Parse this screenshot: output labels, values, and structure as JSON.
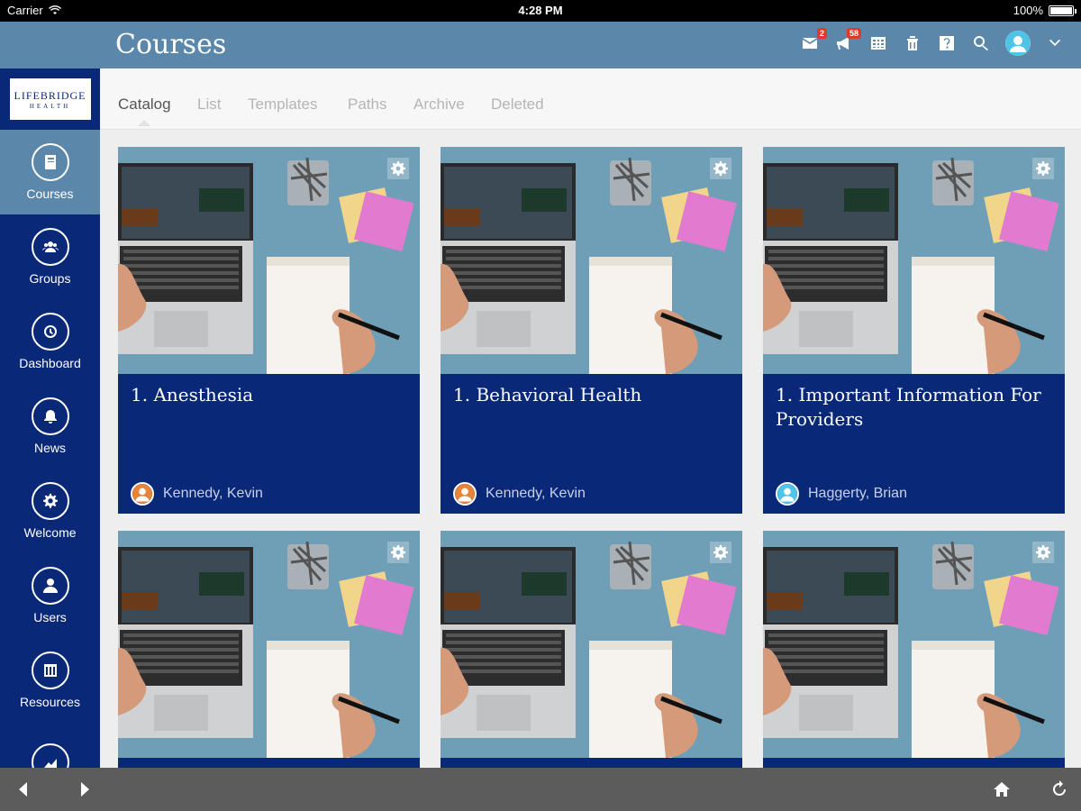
{
  "status": {
    "carrier": "Carrier",
    "time": "4:28 PM",
    "battery": "100%"
  },
  "header": {
    "title": "Courses",
    "mail_badge": "2",
    "announce_badge": "58"
  },
  "logo": {
    "line1": "LIFEBRIDGE",
    "line2": "HEALTH"
  },
  "sidebar": {
    "items": [
      {
        "label": "Courses",
        "icon": "book-icon"
      },
      {
        "label": "Groups",
        "icon": "groups-icon"
      },
      {
        "label": "Dashboard",
        "icon": "dashboard-icon"
      },
      {
        "label": "News",
        "icon": "bell-icon"
      },
      {
        "label": "Welcome",
        "icon": "gear-icon"
      },
      {
        "label": "Users",
        "icon": "user-icon"
      },
      {
        "label": "Resources",
        "icon": "resources-icon"
      },
      {
        "label": "",
        "icon": "chart-icon"
      }
    ]
  },
  "tabs": [
    "Catalog",
    "List",
    "Templates",
    "Paths",
    "Archive",
    "Deleted"
  ],
  "cards": [
    {
      "title": "1. Anesthesia",
      "author": "Kennedy, Kevin",
      "avatar_color": "#e8833a"
    },
    {
      "title": "1. Behavioral Health",
      "author": "Kennedy, Kevin",
      "avatar_color": "#e8833a"
    },
    {
      "title": "1. Important Information For Providers",
      "author": "Haggerty, Brian",
      "avatar_color": "#4fc3e8"
    },
    {
      "title": "",
      "author": "",
      "avatar_color": "#e8833a"
    },
    {
      "title": "",
      "author": "",
      "avatar_color": "#e8833a"
    },
    {
      "title": "",
      "author": "",
      "avatar_color": "#4fc3e8"
    }
  ],
  "colors": {
    "header": "#5a87aa",
    "sidebar": "#0a2878",
    "card": "#0a2878"
  }
}
